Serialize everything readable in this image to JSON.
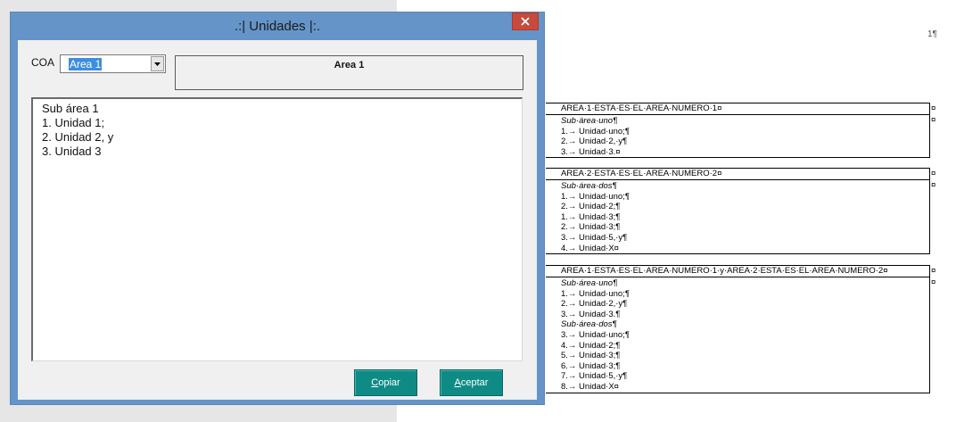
{
  "document": {
    "page_number": "1¶",
    "cell_mark": "¤",
    "tables": [
      {
        "header": "AREA·1·ESTA·ES·EL·AREA·NUMERO·1¤",
        "lines": [
          {
            "text": "Sub·área·uno¶",
            "italic": true
          },
          {
            "text": "1.→ Unidad·uno;¶",
            "italic": false
          },
          {
            "text": "2.→ Unidad·2,·y¶",
            "italic": false
          },
          {
            "text": "3.→ Unidad·3.¤",
            "italic": false
          }
        ]
      },
      {
        "header": "AREA·2·ESTA·ES·EL·AREA·NUMERO·2¤",
        "lines": [
          {
            "text": "Sub·área·dos¶",
            "italic": true
          },
          {
            "text": "1.→ Unidad·uno;¶",
            "italic": false
          },
          {
            "text": "2.→ Unidad·2;¶",
            "italic": false
          },
          {
            "text": "1.→ Unidad·3;¶",
            "italic": false
          },
          {
            "text": "2.→ Unidad·3;¶",
            "italic": false
          },
          {
            "text": "3.→ Unidad·5,·y¶",
            "italic": false
          },
          {
            "text": "4.→ Unidad·X¤",
            "italic": false
          }
        ]
      },
      {
        "header": "AREA·1·ESTA·ES·EL·AREA·NUMERO·1·y·AREA·2·ESTA·ES·EL·AREA·NUMERO·2¤",
        "lines": [
          {
            "text": "Sub·área·uno¶",
            "italic": true
          },
          {
            "text": "1.→ Unidad·uno;¶",
            "italic": false
          },
          {
            "text": "2.→ Unidad·2,·y¶",
            "italic": false
          },
          {
            "text": "3.→ Unidad·3.¶",
            "italic": false
          },
          {
            "text": "Sub·área·dos¶",
            "italic": true
          },
          {
            "text": "3.→ Unidad·uno;¶",
            "italic": false
          },
          {
            "text": "4.→ Unidad·2;¶",
            "italic": false
          },
          {
            "text": "5.→ Unidad·3;¶",
            "italic": false
          },
          {
            "text": "6.→ Unidad·3;¶",
            "italic": false
          },
          {
            "text": "7.→ Unidad·5,·y¶",
            "italic": false
          },
          {
            "text": "8.→ Unidad·X¤",
            "italic": false
          }
        ]
      }
    ]
  },
  "dialog": {
    "title": ".:| Unidades |:.",
    "close_icon": "close-x-icon",
    "coa_label": "COA",
    "coa_selected": "Area 1",
    "area_title": "Area 1",
    "units_lines": [
      "Sub área 1",
      "1. Unidad 1;",
      "2. Unidad 2, y",
      "3. Unidad 3"
    ],
    "copy_button": {
      "accel": "C",
      "rest": "opiar"
    },
    "accept_button": {
      "accel": "A",
      "rest": "ceptar"
    },
    "colors": {
      "titlebar": "#6594c8",
      "close": "#c74b3c",
      "button": "#0f8b85",
      "selection": "#3d8ee0"
    }
  }
}
